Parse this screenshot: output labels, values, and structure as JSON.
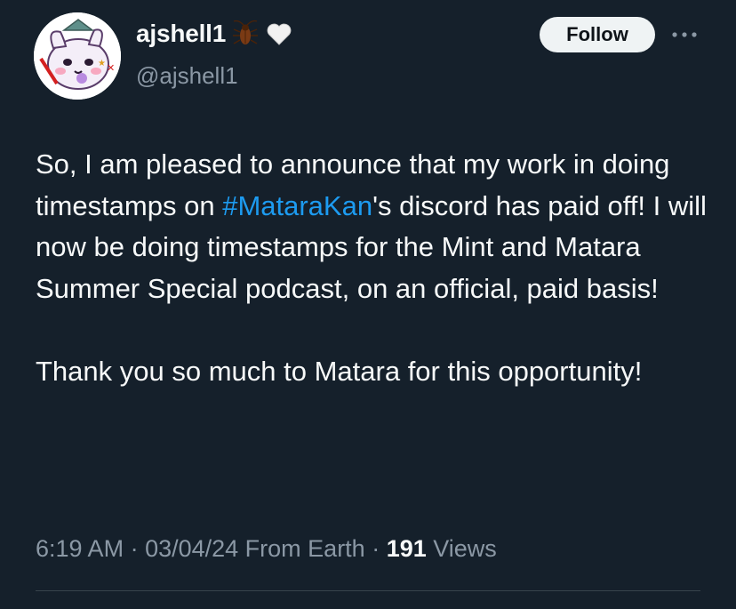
{
  "author": {
    "display_name": "ajshell1",
    "handle": "@ajshell1",
    "emojis": [
      "cockroach-emoji",
      "white-heart-emoji"
    ]
  },
  "actions": {
    "follow_label": "Follow",
    "more_icon": "more-horizontal-icon"
  },
  "tweet": {
    "text_part1": "So, I am pleased to announce that my work in doing timestamps on ",
    "hashtag": "#MataraKan",
    "text_part2": "'s discord has paid off! I will now be doing timestamps for the Mint and Matara Summer Special podcast, on an official, paid basis!\n\nThank you so much to Matara for this opportunity!"
  },
  "meta": {
    "time": "6:19 AM",
    "sep1": " · ",
    "date": "03/04/24",
    "source": " From Earth",
    "sep2": " · ",
    "views_count": "191",
    "views_label": " Views"
  },
  "colors": {
    "background": "#15202b",
    "text": "#f7f9f9",
    "secondary": "#8b98a5",
    "link": "#1d9bf0",
    "follow_bg": "#eff3f4"
  }
}
